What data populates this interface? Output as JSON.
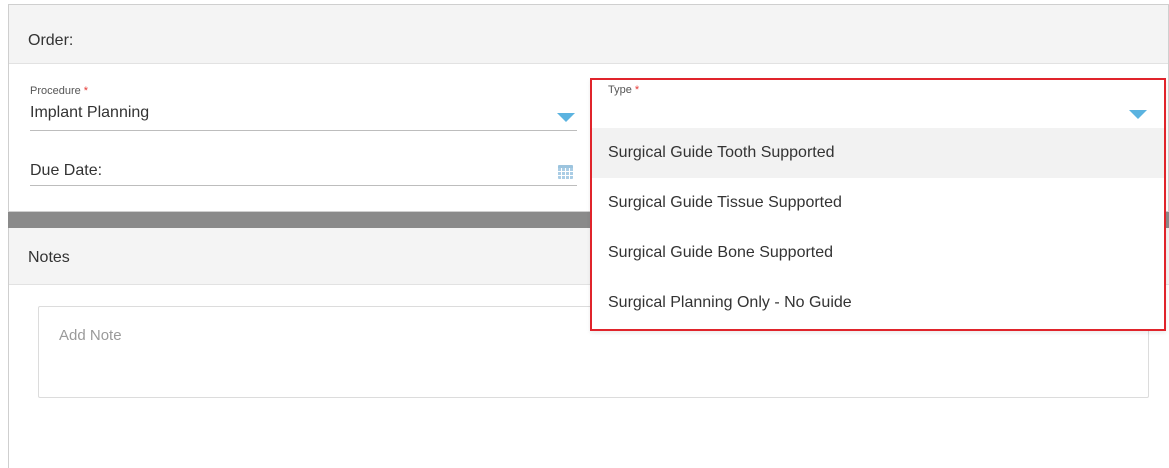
{
  "order": {
    "title": "Order:",
    "procedure": {
      "label": "Procedure",
      "required_mark": "*",
      "value": "Implant Planning"
    },
    "due_date": {
      "label": "Due Date:"
    },
    "type": {
      "label": "Type",
      "required_mark": "*",
      "options": [
        "Surgical Guide Tooth Supported",
        "Surgical Guide Tissue Supported",
        "Surgical Guide Bone Supported",
        "Surgical Planning Only - No Guide"
      ],
      "highlighted_index": 0
    }
  },
  "notes": {
    "title": "Notes",
    "placeholder": "Add Note"
  },
  "colors": {
    "accent_caret": "#5bb3e0",
    "highlight_border": "#e0242b",
    "required": "#e53935"
  },
  "icons": [
    "chevron-down-icon",
    "calendar-icon"
  ]
}
